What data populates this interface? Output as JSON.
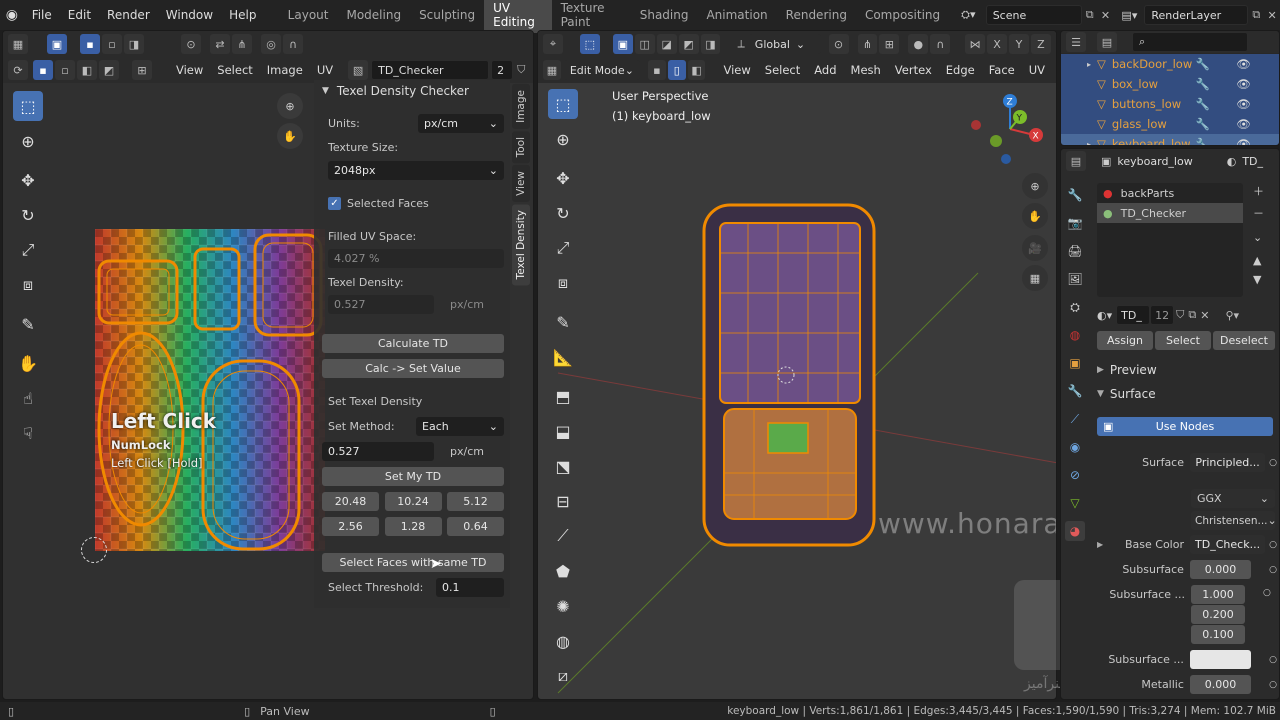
{
  "top": {
    "menus": [
      "File",
      "Edit",
      "Render",
      "Window",
      "Help"
    ],
    "workspaces": [
      "Layout",
      "Modeling",
      "Sculpting",
      "UV Editing",
      "Texture Paint",
      "Shading",
      "Animation",
      "Rendering",
      "Compositing"
    ],
    "active_workspace": "UV Editing",
    "scene": "Scene",
    "view_layer": "RenderLayer"
  },
  "uv_editor": {
    "menus": [
      "View",
      "Select",
      "Image",
      "UV"
    ],
    "image_name": "TD_Checker",
    "image_users": "2",
    "overlay": {
      "title": "Left Click",
      "line1": "NumLock",
      "line2": "Left Click [Hold]"
    }
  },
  "npanel": {
    "panel_title": "Texel Density Checker",
    "tabs": [
      "Image",
      "Tool",
      "View",
      "Texel Density"
    ],
    "units_label": "Units:",
    "units_value": "px/cm",
    "texture_size_label": "Texture Size:",
    "texture_size_value": "2048px",
    "selected_faces_label": "Selected Faces",
    "filled_uv_label": "Filled UV Space:",
    "filled_uv_value": "4.027 %",
    "texel_density_label": "Texel Density:",
    "texel_density_value": "0.527",
    "texel_unit": "px/cm",
    "calculate_btn": "Calculate TD",
    "calc_set_btn": "Calc -> Set Value",
    "set_td_heading": "Set Texel Density",
    "set_method_label": "Set Method:",
    "set_method_value": "Each",
    "set_value": "0.527",
    "set_unit": "px/cm",
    "set_my_td_btn": "Set My TD",
    "presets": [
      "20.48",
      "10.24",
      "5.12",
      "2.56",
      "1.28",
      "0.64"
    ],
    "select_faces_btn": "Select Faces with same TD",
    "threshold_label": "Select Threshold:",
    "threshold_value": "0.1"
  },
  "viewport": {
    "mode": "Edit Mode",
    "menus": [
      "View",
      "Select",
      "Add",
      "Mesh",
      "Vertex",
      "Edge",
      "Face",
      "UV"
    ],
    "orientation": "Global",
    "info_line1": "User Perspective",
    "info_line2": "(1) keyboard_low",
    "watermark": "www.honaramiz.com",
    "watermark_fa": "هنرآمیز",
    "xyz": [
      "X",
      "Y",
      "Z"
    ]
  },
  "outliner": {
    "items": [
      "backDoor_low",
      "box_low",
      "buttons_low",
      "glass_low",
      "keyboard_low"
    ]
  },
  "properties": {
    "object": "keyboard_low",
    "tab_short": "TD_",
    "materials": [
      "backParts",
      "TD_Checker"
    ],
    "mat_name": "TD_",
    "mat_users": "12",
    "assign": "Assign",
    "select": "Select",
    "deselect": "Deselect",
    "preview": "Preview",
    "surface": "Surface",
    "use_nodes": "Use Nodes",
    "surface_label": "Surface",
    "surface_value": "Principled...",
    "ggx": "GGX",
    "christensen": "Christensen...",
    "base_color_label": "Base Color",
    "base_color_value": "TD_Check...",
    "subsurface_label": "Subsurface",
    "subsurface_value": "0.000",
    "subsurface_r_label": "Subsurface ...",
    "subsurface_r": [
      "1.000",
      "0.200",
      "0.100"
    ],
    "subsurface_c_label": "Subsurface ...",
    "metallic_label": "Metallic",
    "metallic_value": "0.000"
  },
  "status": {
    "pan_view": "Pan View",
    "stats": "keyboard_low | Verts:1,861/1,861 | Edges:3,445/3,445 | Faces:1,590/1,590 | Tris:3,274 | Mem: 102.7 MiB"
  },
  "colors": {
    "accent": "#4772b3",
    "select_orange": "#f08a00",
    "outliner_sel": "#334d80"
  }
}
